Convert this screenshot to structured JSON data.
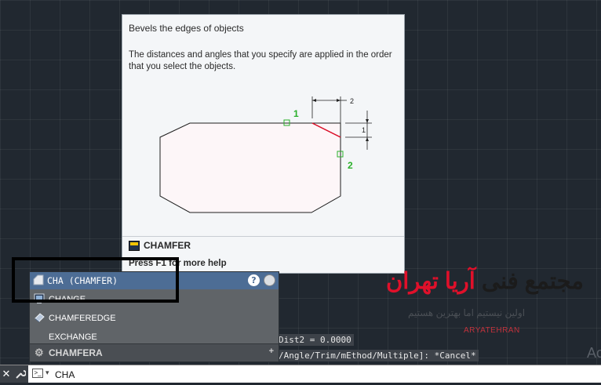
{
  "tooltip": {
    "title": "Bevels the edges of objects",
    "description": "The distances and angles that you specify are applied in the order that you select the objects.",
    "figure": {
      "label_1": "1",
      "label_2": "2",
      "dim_2": "2",
      "dim_1": "1"
    },
    "command_name": "CHAMFER",
    "help": "Press F1 for more help"
  },
  "autocomplete": {
    "header": "CHA (CHAMFER)",
    "help_label": "?",
    "items": [
      {
        "label": "CHANGE",
        "icon": "change-icon"
      },
      {
        "label": "CHAMFEREDGE",
        "icon": "chamferedge-icon"
      },
      {
        "label": "EXCHANGE",
        "icon": ""
      }
    ],
    "footer": "CHAMFERA",
    "footer_plus": "+"
  },
  "history": {
    "line1": "Dist2 = 0.0000",
    "line2": "/Angle/Trim/mEthod/Multiple]: *Cancel*"
  },
  "command_line": {
    "close": "✕",
    "input": "CHA"
  },
  "watermark": {
    "title_black": "مجتمع فنی",
    "title_red": "آریا تهران",
    "subtitle": "اولین نیستیم اما بهترین هستیم",
    "latin": "ARYATEHRAN",
    "corner": "Ac"
  },
  "colors": {
    "background": "#212830",
    "header_blue": "#4d6d95",
    "chamfer_red": "#e0102a",
    "grip_green": "#2bb02b"
  }
}
